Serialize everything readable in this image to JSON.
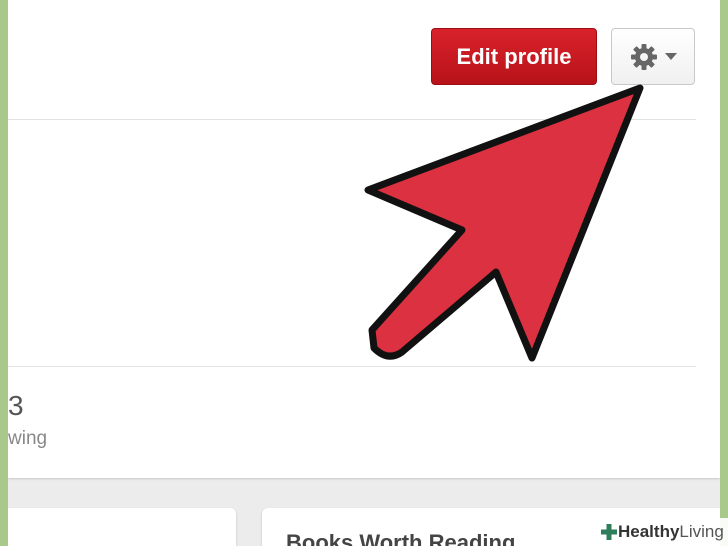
{
  "profile": {
    "edit_button_label": "Edit profile",
    "settings_icon": "gear-icon",
    "dropdown_icon": "caret-down-icon"
  },
  "stats": {
    "count_partial": "3",
    "label_partial": "wing"
  },
  "boards": {
    "second_title_partial": "Books Worth Reading"
  },
  "watermark": {
    "brand": "Healthy",
    "suffix": " Living"
  },
  "colors": {
    "edit_button": "#c8161d",
    "arrow_fill": "#dc3141",
    "frame_border": "#a9c98a"
  }
}
